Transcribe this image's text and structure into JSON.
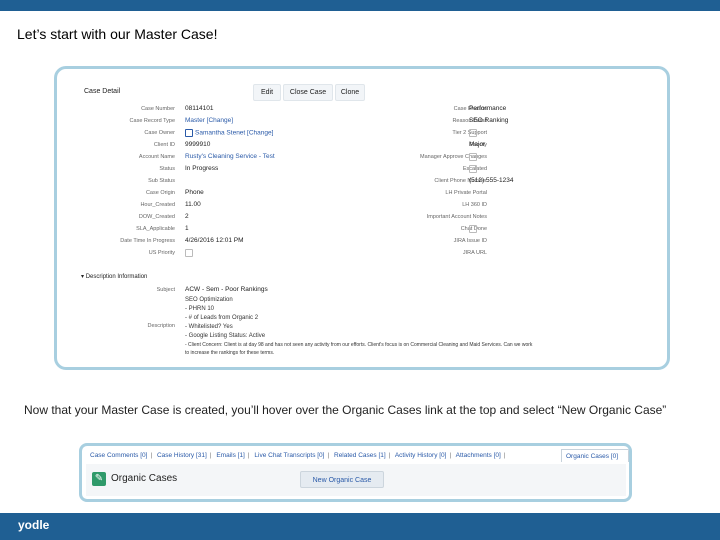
{
  "slide": {
    "title": "Let’s start with our Master Case!",
    "caption": "Now that your Master Case is created, you’ll hover over the Organic Cases link at the top and select “New Organic Case”",
    "logo": "yodle"
  },
  "case_detail": {
    "title": "Case Detail",
    "buttons": [
      "Edit",
      "Close Case",
      "Clone"
    ],
    "left_fields": [
      {
        "label": "Case Number",
        "value": "08114101"
      },
      {
        "label": "Case Record Type",
        "value": "Master [Change]"
      },
      {
        "label": "Case Owner",
        "value": "Samantha Stenet [Change]"
      },
      {
        "label": "Client ID",
        "value": "9999910"
      },
      {
        "label": "Account Name",
        "value": "Rusty's Cleaning Service - Test"
      },
      {
        "label": "Status",
        "value": "In Progress"
      },
      {
        "label": "Sub Status",
        "value": ""
      },
      {
        "label": "Case Origin",
        "value": "Phone"
      },
      {
        "label": "Hour_Created",
        "value": "11.00"
      },
      {
        "label": "DOW_Created",
        "value": "2"
      },
      {
        "label": "SLA_Applicable",
        "value": "1"
      },
      {
        "label": "Date Time In Progress",
        "value": "4/26/2016 12:01 PM"
      },
      {
        "label": "US Priority",
        "value": ""
      }
    ],
    "right_fields": [
      {
        "label": "Case Reason",
        "value": "Performance"
      },
      {
        "label": "Reason Detail",
        "value": "SEO Ranking"
      },
      {
        "label": "Tier 2 Support",
        "value": ""
      },
      {
        "label": "Priority",
        "value": "Major"
      },
      {
        "label": "Manager Approve Changes",
        "value": ""
      },
      {
        "label": "Escalated",
        "value": ""
      },
      {
        "label": "Client Phone Number",
        "value": "(512) 555-1234"
      },
      {
        "label": "LH Private Portal",
        "value": ""
      },
      {
        "label": "LH 360 ID",
        "value": ""
      },
      {
        "label": "Important Account Notes",
        "value": ""
      },
      {
        "label": "Chat Done",
        "value": ""
      },
      {
        "label": "JIRA Issue ID",
        "value": ""
      },
      {
        "label": "JIRA URL",
        "value": ""
      }
    ],
    "description_section": "Description Information",
    "subject_label": "Subject",
    "subject_value": "ACW - Sem - Poor Rankings",
    "description_label": "Description",
    "description_lines": [
      "SEO Optimization",
      "- PHRN 10",
      "- # of Leads from Organic 2",
      "- Whitelisted? Yes",
      "- Google Listing Status: Active",
      "- Client Concern: Client is at day 98 and has not seen any activity from our efforts. Client's focus is on Commercial Cleaning and Maid Services. Can we work",
      "to increase the rankings for these terms."
    ]
  },
  "related": {
    "tabs": [
      "Case Comments [0]",
      "Case History [31]",
      "Emails [1]",
      "Live Chat Transcripts [0]",
      "Related Cases [1]",
      "Activity History [0]",
      "Attachments [0]"
    ],
    "active_tab": "Organic Cases [0]",
    "section_title": "Organic Cases",
    "new_button": "New Organic Case"
  }
}
